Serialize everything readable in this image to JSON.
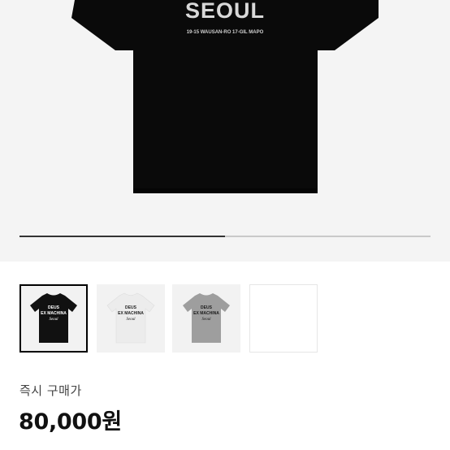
{
  "hero": {
    "shirt_text": "SEOUL",
    "shirt_address": "19-15 WAUSAN-RO 17-GIL MAPO",
    "shirt_color": "#0a0a0a"
  },
  "gallery": {
    "progress": 0.5,
    "thumbnails": [
      {
        "shirt_color": "#111111",
        "text_color": "#ffffff",
        "lines": [
          "DEUS",
          "EX MACHINA",
          "Seoul"
        ],
        "selected": true
      },
      {
        "shirt_color": "#ececec",
        "text_color": "#222222",
        "lines": [
          "DEUS",
          "EX MACHINA",
          "Seoul"
        ],
        "selected": false
      },
      {
        "shirt_color": "#9e9e9e",
        "text_color": "#1a1a1a",
        "lines": [
          "DEUS",
          "EX MACHINA",
          "Seoul"
        ],
        "selected": false
      },
      {
        "empty": true
      }
    ]
  },
  "purchase": {
    "label": "즉시 구매가",
    "price": "80,000원"
  }
}
